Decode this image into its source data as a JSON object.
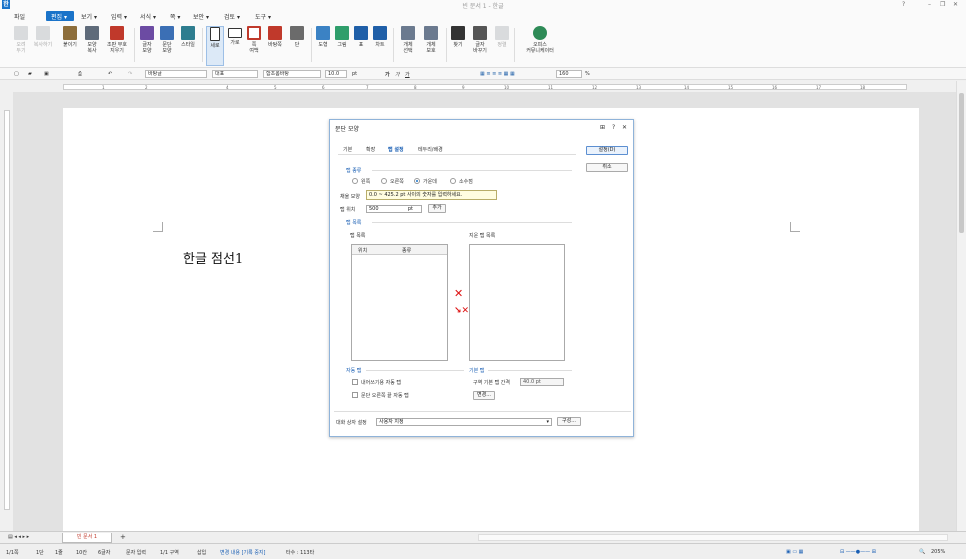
{
  "window": {
    "title": "빈 문서 1 - 한글",
    "app_icon": "한",
    "controls": [
      "?",
      "–",
      "❐",
      "✕"
    ]
  },
  "menu": {
    "items": [
      "파일",
      "편집 ▾",
      "보기 ▾",
      "입력 ▾",
      "서식 ▾",
      "쪽 ▾",
      "보안 ▾",
      "검토 ▾",
      "도구 ▾"
    ],
    "active_index": 1
  },
  "ribbon": {
    "buttons": [
      {
        "label": "오려\n두기",
        "icon": "scissors-icon",
        "disabled": true
      },
      {
        "label": "복사하기",
        "icon": "copy-icon",
        "disabled": true
      },
      {
        "label": "붙이기",
        "icon": "paste-icon"
      },
      {
        "label": "모양\n복사",
        "icon": "format-copy-icon"
      },
      {
        "label": "조판 부호\n지우기",
        "icon": "erase-code-icon"
      },
      {
        "label": "글자\n모양",
        "icon": "char-shape-icon"
      },
      {
        "label": "문단\n모양",
        "icon": "para-shape-icon"
      },
      {
        "label": "스타일",
        "icon": "style-icon"
      },
      {
        "label": "세로",
        "icon": "portrait-icon"
      },
      {
        "label": "가로",
        "icon": "landscape-icon"
      },
      {
        "label": "쪽\n여백",
        "icon": "margin-icon"
      },
      {
        "label": "바탕쪽",
        "icon": "master-page-icon"
      },
      {
        "label": "단",
        "icon": "columns-icon"
      },
      {
        "label": "도형",
        "icon": "shape-icon"
      },
      {
        "label": "그림",
        "icon": "picture-icon"
      },
      {
        "label": "표",
        "icon": "table-icon"
      },
      {
        "label": "차트",
        "icon": "chart-icon"
      },
      {
        "label": "개체\n선택",
        "icon": "object-select-icon"
      },
      {
        "label": "개체\n보호",
        "icon": "object-protect-icon"
      },
      {
        "label": "찾기",
        "icon": "find-icon"
      },
      {
        "label": "글자\n바꾸기",
        "icon": "replace-icon"
      },
      {
        "label": "정렬",
        "icon": "sort-icon",
        "disabled": true
      },
      {
        "label": "오피스\n커뮤니케이터",
        "icon": "communicator-icon"
      }
    ]
  },
  "format_bar": {
    "style": "바탕글",
    "lang": "대표",
    "font": "함초롬바탕",
    "size": "10.0",
    "unit": "pt",
    "bold": "가",
    "italic": "가",
    "underline": "가",
    "line_spacing": "160",
    "percent": "%"
  },
  "ruler": {
    "numbers": [
      "1",
      "2",
      "3",
      "4",
      "5",
      "6",
      "7",
      "8",
      "9",
      "10",
      "11",
      "12",
      "13",
      "14",
      "15",
      "16",
      "17",
      "18"
    ]
  },
  "document": {
    "text": "한글 점선1"
  },
  "dialog": {
    "title": "문단 모양",
    "title_icons": [
      "⊞",
      "?",
      "✕"
    ],
    "tabs": [
      "기본",
      "확장",
      "탭 설정",
      "테두리/배경"
    ],
    "active_tab": 2,
    "buttons": {
      "ok": "설정(D)",
      "cancel": "취소",
      "add": "추가",
      "change": "변경...",
      "configure": "구성..."
    },
    "tab_kind": {
      "section": "탭 종류",
      "options": [
        "왼쪽",
        "오른쪽",
        "가운데",
        "소수점"
      ],
      "selected": 2,
      "fill_label": "채울 모양",
      "pos_label": "탭 위치",
      "pos_value": "500",
      "pos_unit": "pt"
    },
    "tooltip": "0.0 ~ 425.2 pt 사이의 숫자를 입력하세요.",
    "tab_list": {
      "section": "탭 목록",
      "list_label": "탭 목록",
      "col_pos": "위치",
      "col_kind": "종류",
      "removed_label": "지운 탭 목록"
    },
    "auto_tab": {
      "section": "자동 탭",
      "cb1": "내어쓰기용 자동 탭",
      "cb2": "문단 오른쪽 끝 자동 탭"
    },
    "default_tab": {
      "section": "기본 탭",
      "label": "구역 기본 탭 간격",
      "value": "40.0 pt"
    },
    "footer": {
      "label": "대화 상자 설정",
      "value": "사용자 지정"
    }
  },
  "tabbar": {
    "doc_tab": "빈 문서 1",
    "add": "+"
  },
  "status": {
    "items": [
      "1/1쪽",
      "1단",
      "1줄",
      "10칸",
      "6글자",
      "문자 입력",
      "1/1 구역",
      "삽입",
      "변경 내용 [기록 중지]",
      "타수 : 113타"
    ],
    "zoom": "205%"
  }
}
